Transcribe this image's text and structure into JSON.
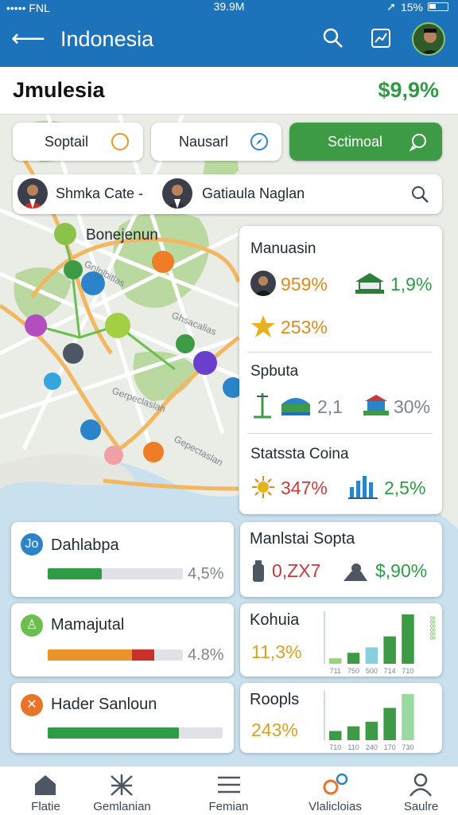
{
  "status_bar": {
    "carrier": "••••• FNL",
    "time": "39.9M",
    "battery": "15%"
  },
  "app_bar": {
    "title": "Indonesia"
  },
  "header": {
    "name": "Jmulesia",
    "change": "$9,9%"
  },
  "filters": [
    {
      "label": "Soptail"
    },
    {
      "label": "Nausarl"
    },
    {
      "label": "Sctimoal"
    }
  ],
  "search": {
    "person1": "Shmka Cate -",
    "person2": "Gatiaula Naglan"
  },
  "map": {
    "label": "Bonejenun",
    "road_labels": [
      "Gnlnlbitlas",
      "Ghsacalias",
      "Gerpeclaslah",
      "Gepectaslan"
    ]
  },
  "panel": {
    "section1": {
      "title": "Manuasin",
      "v1": "959%",
      "v2": "1,9%",
      "v3": "253%"
    },
    "section2": {
      "title": "Spbuta",
      "v1": "2,1",
      "v2": "30%"
    },
    "section3": {
      "title": "Statssta Coina",
      "v1": "347%",
      "v2": "2,5%"
    }
  },
  "progress_cards": [
    {
      "badge": "Jo",
      "title": "Dahlabpa",
      "value": "4,5%",
      "fill": 0.4,
      "color": "#2f9b46"
    },
    {
      "badge": "♙",
      "title": "Mamajutal",
      "value": "4.8%",
      "fill": 0.75,
      "color": "#e8942a"
    },
    {
      "badge": "✕",
      "title": "Hader Sanloun",
      "value": "",
      "fill": 0.75,
      "color": "#2f9b46"
    }
  ],
  "stat_card": {
    "title": "Manlstai Sopta",
    "v1": "0,ZX7",
    "v2": "$,90%"
  },
  "chart_cards": [
    {
      "title": "Kohuia",
      "value": "11,3%",
      "ticks": [
        "711",
        "750",
        "500",
        "714",
        "710"
      ],
      "side": "888888"
    },
    {
      "title": "Roopls",
      "value": "243%",
      "ticks": [
        "710",
        "110",
        "240",
        "170",
        "730"
      ],
      "side": ""
    }
  ],
  "chart_data": [
    {
      "type": "bar",
      "title": "Kohuia",
      "categories": [
        "711",
        "750",
        "500",
        "714",
        "710"
      ],
      "values": [
        1,
        2,
        3,
        5,
        9
      ],
      "colors": [
        "#9bd37a",
        "#3d9a45",
        "#86d1e0",
        "#3d9a45",
        "#3d9a45"
      ]
    },
    {
      "type": "bar",
      "title": "Roopls",
      "categories": [
        "710",
        "110",
        "240",
        "170",
        "730"
      ],
      "values": [
        2,
        3,
        4,
        7,
        10
      ],
      "colors": [
        "#3d9a45",
        "#3d9a45",
        "#3d9a45",
        "#3d9a45",
        "#9bd9a2"
      ]
    }
  ],
  "tabs": [
    {
      "label": "Flatie",
      "icon": "home-icon"
    },
    {
      "label": "Gemlanian",
      "icon": "network-icon"
    },
    {
      "label": "Femian",
      "icon": "list-icon"
    },
    {
      "label": "Vlalicloias",
      "icon": "pin-icon"
    },
    {
      "label": "Saulre",
      "icon": "person-icon"
    }
  ]
}
